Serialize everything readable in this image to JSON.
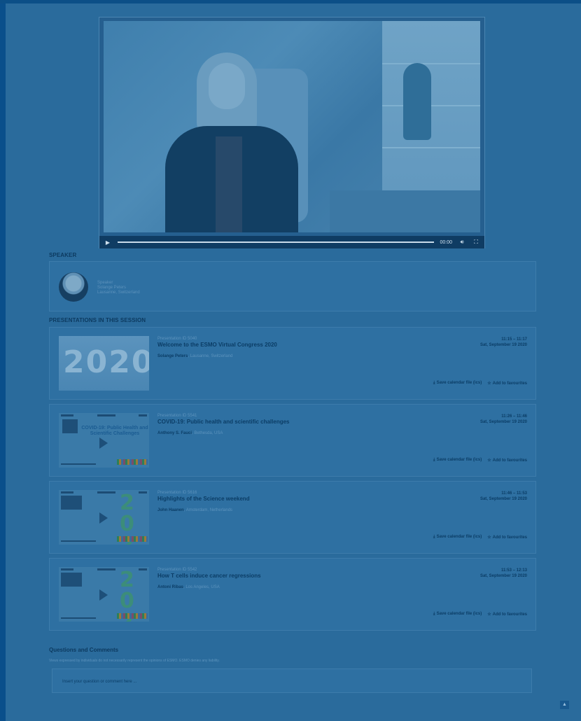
{
  "video": {
    "time": "00:00",
    "play_icon": "play-icon",
    "volume_icon": "volume-icon",
    "fullscreen_icon": "fullscreen-icon"
  },
  "speaker_section": {
    "title": "SPEAKER",
    "role": "Speaker",
    "name": "Solange Peters",
    "location": "Lausanne, Switzerland"
  },
  "presentations_section": {
    "title": "PRESENTATIONS IN THIS SESSION",
    "items": [
      {
        "id_label": "Presentation ID 5040",
        "title": "Welcome to the ESMO Virtual Congress 2020",
        "author": "Solange Peters",
        "author_location": ", Lausanne, Switzerland",
        "time": "11:15 – 11:17",
        "date": "Sat, September 19 2020",
        "thumb_text": "2020"
      },
      {
        "id_label": "Presentation ID 5541",
        "title": "COVID-19: Public health and scientific challenges",
        "author": "Anthony S. Fauci",
        "author_location": ", Bethesda, USA",
        "time": "11:26 – 11:46",
        "date": "Sat, September 19 2020",
        "thumb_text": "COVID-19: Public Health and Scientific Challenges"
      },
      {
        "id_label": "Presentation ID 5616",
        "title": "Highlights of the Science weekend",
        "author": "John Haanen",
        "author_location": ", Amsterdam, Netherlands",
        "time": "11:46 – 11:53",
        "date": "Sat, September 19 2020",
        "thumb_text": "2020"
      },
      {
        "id_label": "Presentation ID 5542",
        "title": "How T cells induce cancer regressions",
        "author": "Antoni Ribas",
        "author_location": ", Los Angeles, USA",
        "time": "11:53 – 12:13",
        "date": "Sat, September 19 2020",
        "thumb_text": "2020"
      }
    ],
    "save_label": "Save calendar file (ics)",
    "fav_label": "Add to favourites"
  },
  "qa": {
    "title": "Questions and Comments",
    "disclaimer": "Views expressed by individuals do not necessarily represent the opinions of ESMO. ESMO denies any liability.",
    "placeholder": "Insert your question or comment here ..."
  },
  "scroll_top_icon": "arrow-up-icon"
}
